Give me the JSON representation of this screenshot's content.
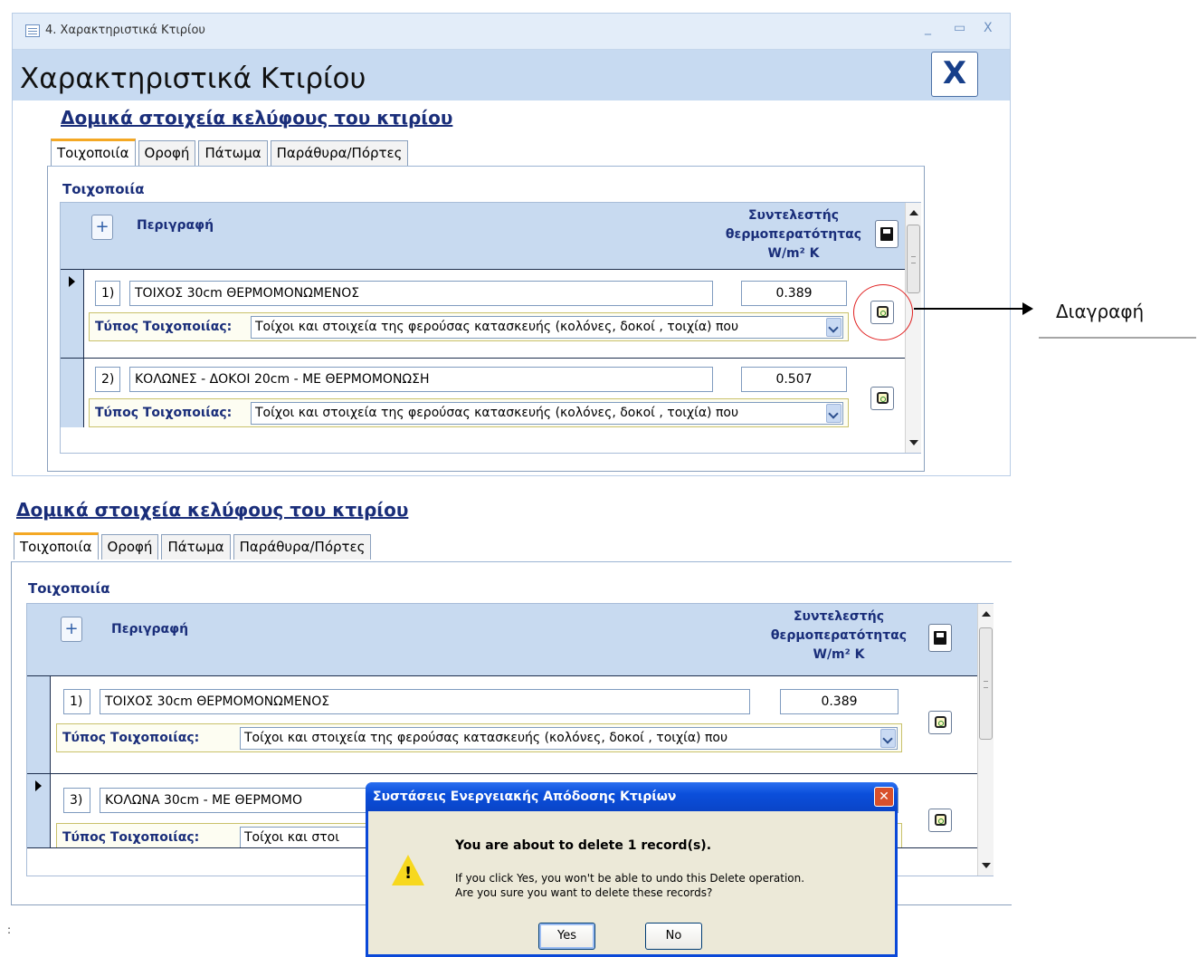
{
  "window": {
    "title": "4. Χαρακτηριστικά Κτιρίου",
    "minimize": "_",
    "maximize": "▭",
    "close": "X"
  },
  "form": {
    "heading": "Χαρακτηριστικά Κτιρίου",
    "close_label": "X"
  },
  "section_title": "Δομικά στοιχεία κελύφους του κτιρίου",
  "tabs": [
    "Τοιχοποιία",
    "Οροφή",
    "Πάτωμα",
    "Παράθυρα/Πόρτες"
  ],
  "panel_label": "Τοιχοποιία",
  "grid": {
    "add_label": "+",
    "col_description": "Περιγραφή",
    "col_coef_line1": "Συντελεστής",
    "col_coef_line2": "θερμοπερατότητας",
    "col_coef_unit": "W/m² K",
    "type_label": "Τύπος Τοιχοποιίας:"
  },
  "top_records": [
    {
      "num": "1)",
      "name": "ΤΟΙΧΟΣ 30cm ΘΕΡΜΟΜΟΝΩΜΕΝΟΣ",
      "value": "0.389",
      "type": "Τοίχοι και στοιχεία της φερούσας κατασκευής (κολόνες, δοκοί , τοιχία) που"
    },
    {
      "num": "2)",
      "name": "ΚΟΛΩΝΕΣ - ΔΟΚΟΙ 20cm - ΜΕ ΘΕΡΜΟΜΟΝΩΣΗ",
      "value": "0.507",
      "type": "Τοίχοι και στοιχεία της φερούσας κατασκευής (κολόνες, δοκοί , τοιχία) που"
    }
  ],
  "bottom_records": [
    {
      "num": "1)",
      "name": "ΤΟΙΧΟΣ 30cm ΘΕΡΜΟΜΟΝΩΜΕΝΟΣ",
      "value": "0.389",
      "type": "Τοίχοι και στοιχεία της φερούσας κατασκευής (κολόνες, δοκοί , τοιχία) που"
    },
    {
      "num": "3)",
      "name": "ΚΟΛΩΝΑ 30cm - ΜΕ ΘΕΡΜΟΜΟ",
      "value": "",
      "type": "Τοίχοι και στοι"
    }
  ],
  "callout": "Διαγραφή",
  "dialog": {
    "title": "Συστάσεις Ενεργειακής Απόδοσης Κτιρίων",
    "close": "✕",
    "heading": "You are about to delete 1 record(s).",
    "line1": "If you click Yes, you won't be able to undo this Delete operation.",
    "line2": "Are you sure you want to delete these records?",
    "yes": "Yes",
    "no": "No"
  },
  "stray_mark": ":"
}
